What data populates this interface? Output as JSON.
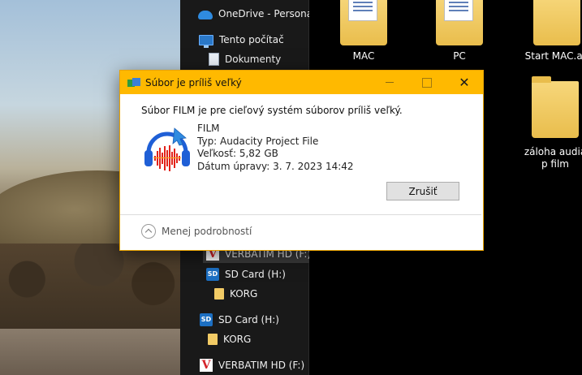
{
  "nav": {
    "items": [
      {
        "label": "OneDrive - Personal",
        "icon": "onedrive-cloud-icon"
      },
      {
        "label": "Tento počítač",
        "icon": "computer-icon"
      },
      {
        "label": "Dokumenty",
        "icon": "documents-icon"
      },
      {
        "label": "VERBATIM HD (F:)",
        "icon": "verbatim-drive-icon"
      },
      {
        "label": "SD Card (H:)",
        "icon": "sd-card-icon"
      },
      {
        "label": "KORG",
        "icon": "folder-icon"
      },
      {
        "label": "SD Card (H:)",
        "icon": "sd-card-icon"
      },
      {
        "label": "KORG",
        "icon": "folder-icon"
      },
      {
        "label": "VERBATIM HD (F:)",
        "icon": "verbatim-drive-icon"
      }
    ]
  },
  "folders": [
    {
      "label": "MAC"
    },
    {
      "label": "PC"
    },
    {
      "label": "Start MAC.ap"
    },
    {
      "label": "záloha audia p film"
    }
  ],
  "dialog": {
    "title": "Súbor je príliš veľký",
    "message": "Súbor FILM je pre cieľový systém súborov príliš veľký.",
    "file": {
      "name": "FILM",
      "type": "Typ: Audacity Project File",
      "size": "Veľkosť: 5,82 GB",
      "modified": "Dátum úpravy: 3. 7. 2023 14:42"
    },
    "cancel_label": "Zrušiť",
    "details_label": "Menej podrobností",
    "colors": {
      "titlebar": "#ffb900",
      "icon_blue": "#1f5fd6",
      "waveform_red": "#e2231a"
    }
  }
}
